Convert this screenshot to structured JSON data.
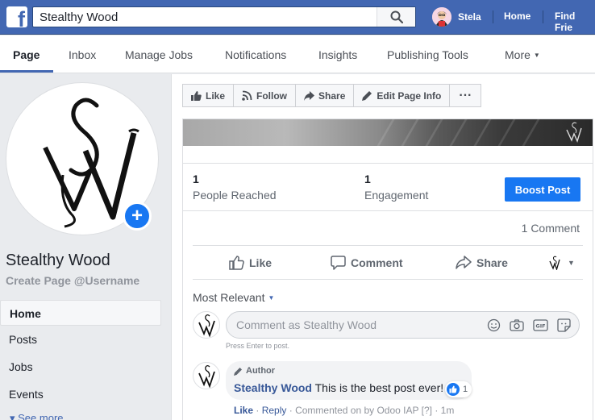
{
  "topbar": {
    "logo_letter": "f",
    "search_value": "Stealthy Wood",
    "user_name": "Stela",
    "home_label": "Home",
    "find_friends_label": "Find Frie"
  },
  "nav": {
    "tabs": [
      {
        "label": "Page"
      },
      {
        "label": "Inbox"
      },
      {
        "label": "Manage Jobs"
      },
      {
        "label": "Notifications"
      },
      {
        "label": "Insights"
      },
      {
        "label": "Publishing Tools"
      },
      {
        "label": "More"
      }
    ]
  },
  "sidebar": {
    "page_name": "Stealthy Wood",
    "username_link": "Create Page @Username",
    "items": [
      {
        "label": "Home"
      },
      {
        "label": "Posts"
      },
      {
        "label": "Jobs"
      },
      {
        "label": "Events"
      }
    ],
    "see_more": "See more"
  },
  "action_bar": {
    "like": "Like",
    "follow": "Follow",
    "share": "Share",
    "edit_page_info": "Edit Page Info",
    "more": "···"
  },
  "post": {
    "stats": [
      {
        "value": "1",
        "label": "People Reached"
      },
      {
        "value": "1",
        "label": "Engagement"
      }
    ],
    "boost_label": "Boost Post",
    "comment_count": "1 Comment",
    "reactions": {
      "like": "Like",
      "comment": "Comment",
      "share": "Share"
    },
    "sort_label": "Most Relevant",
    "comment_placeholder": "Comment as Stealthy Wood",
    "hint": "Press Enter to post.",
    "comment": {
      "badge": "Author",
      "author": "Stealthy Wood",
      "text": "This is the best post ever!",
      "like_count": "1",
      "action_like": "Like",
      "action_reply": "Reply",
      "meta": "Commented on by Odoo IAP",
      "help": "[?]",
      "time": "1m"
    }
  },
  "colors": {
    "brand": "#4267b2",
    "accent": "#1877f2",
    "link": "#385898"
  }
}
